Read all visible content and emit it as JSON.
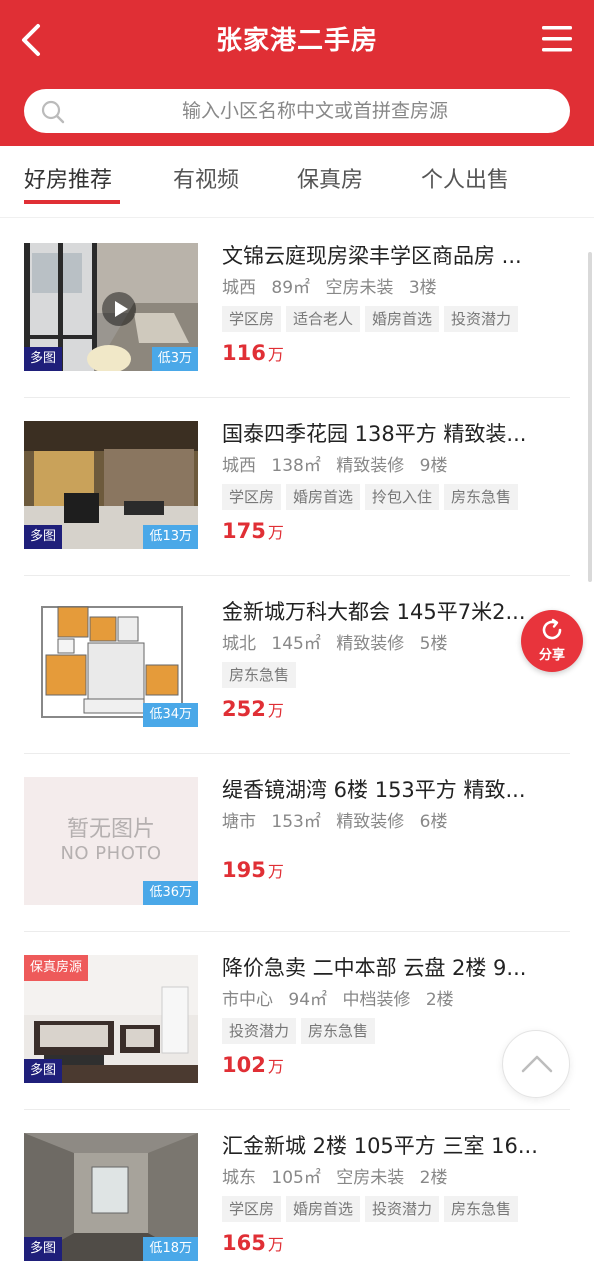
{
  "header": {
    "title": "张家港二手房",
    "back_icon": "chevron-left-icon",
    "menu_icon": "hamburger-menu-icon",
    "background_color": "#e02f35"
  },
  "search": {
    "placeholder": "输入小区名称中文或首拼查房源",
    "value": ""
  },
  "tabs": [
    {
      "label": "好房推荐",
      "active": true
    },
    {
      "label": "有视频",
      "active": false
    },
    {
      "label": "保真房",
      "active": false
    },
    {
      "label": "个人出售",
      "active": false
    }
  ],
  "listings": [
    {
      "title": "文锦云庭现房梁丰学区商品房 ...",
      "district": "城西",
      "area": "89㎡",
      "decoration": "空房未装",
      "floor": "3楼",
      "tags": [
        "学区房",
        "适合老人",
        "婚房首选",
        "投资潜力"
      ],
      "price": "116",
      "price_unit": "万",
      "badge_multi": "多图",
      "badge_low": "低3万",
      "has_video": true
    },
    {
      "title": "国泰四季花园 138平方 精致装...",
      "district": "城西",
      "area": "138㎡",
      "decoration": "精致装修",
      "floor": "9楼",
      "tags": [
        "学区房",
        "婚房首选",
        "拎包入住",
        "房东急售"
      ],
      "price": "175",
      "price_unit": "万",
      "badge_multi": "多图",
      "badge_low": "低13万"
    },
    {
      "title": "金新城万科大都会 145平7米2...",
      "district": "城北",
      "area": "145㎡",
      "decoration": "精致装修",
      "floor": "5楼",
      "tags": [
        "房东急售"
      ],
      "price": "252",
      "price_unit": "万",
      "badge_low": "低34万"
    },
    {
      "title": "缇香镜湖湾 6楼 153平方 精致...",
      "district": "塘市",
      "area": "153㎡",
      "decoration": "精致装修",
      "floor": "6楼",
      "tags": [],
      "price": "195",
      "price_unit": "万",
      "badge_low": "低36万",
      "no_photo_cn": "暂无图片",
      "no_photo_en": "NO PHOTO"
    },
    {
      "title": "降价急卖 二中本部 云盘 2楼 9...",
      "district": "市中心",
      "area": "94㎡",
      "decoration": "中档装修",
      "floor": "2楼",
      "tags": [
        "投资潜力",
        "房东急售"
      ],
      "price": "102",
      "price_unit": "万",
      "badge_multi": "多图",
      "badge_verified": "保真房源"
    },
    {
      "title": "汇金新城 2楼 105平方 三室 16...",
      "district": "城东",
      "area": "105㎡",
      "decoration": "空房未装",
      "floor": "2楼",
      "tags": [
        "学区房",
        "婚房首选",
        "投资潜力",
        "房东急售"
      ],
      "price": "165",
      "price_unit": "万",
      "badge_multi": "多图",
      "badge_low": "低18万"
    }
  ],
  "floating": {
    "share_label": "分享",
    "share_icon": "share-icon",
    "to_top_icon": "chevron-up-icon"
  }
}
